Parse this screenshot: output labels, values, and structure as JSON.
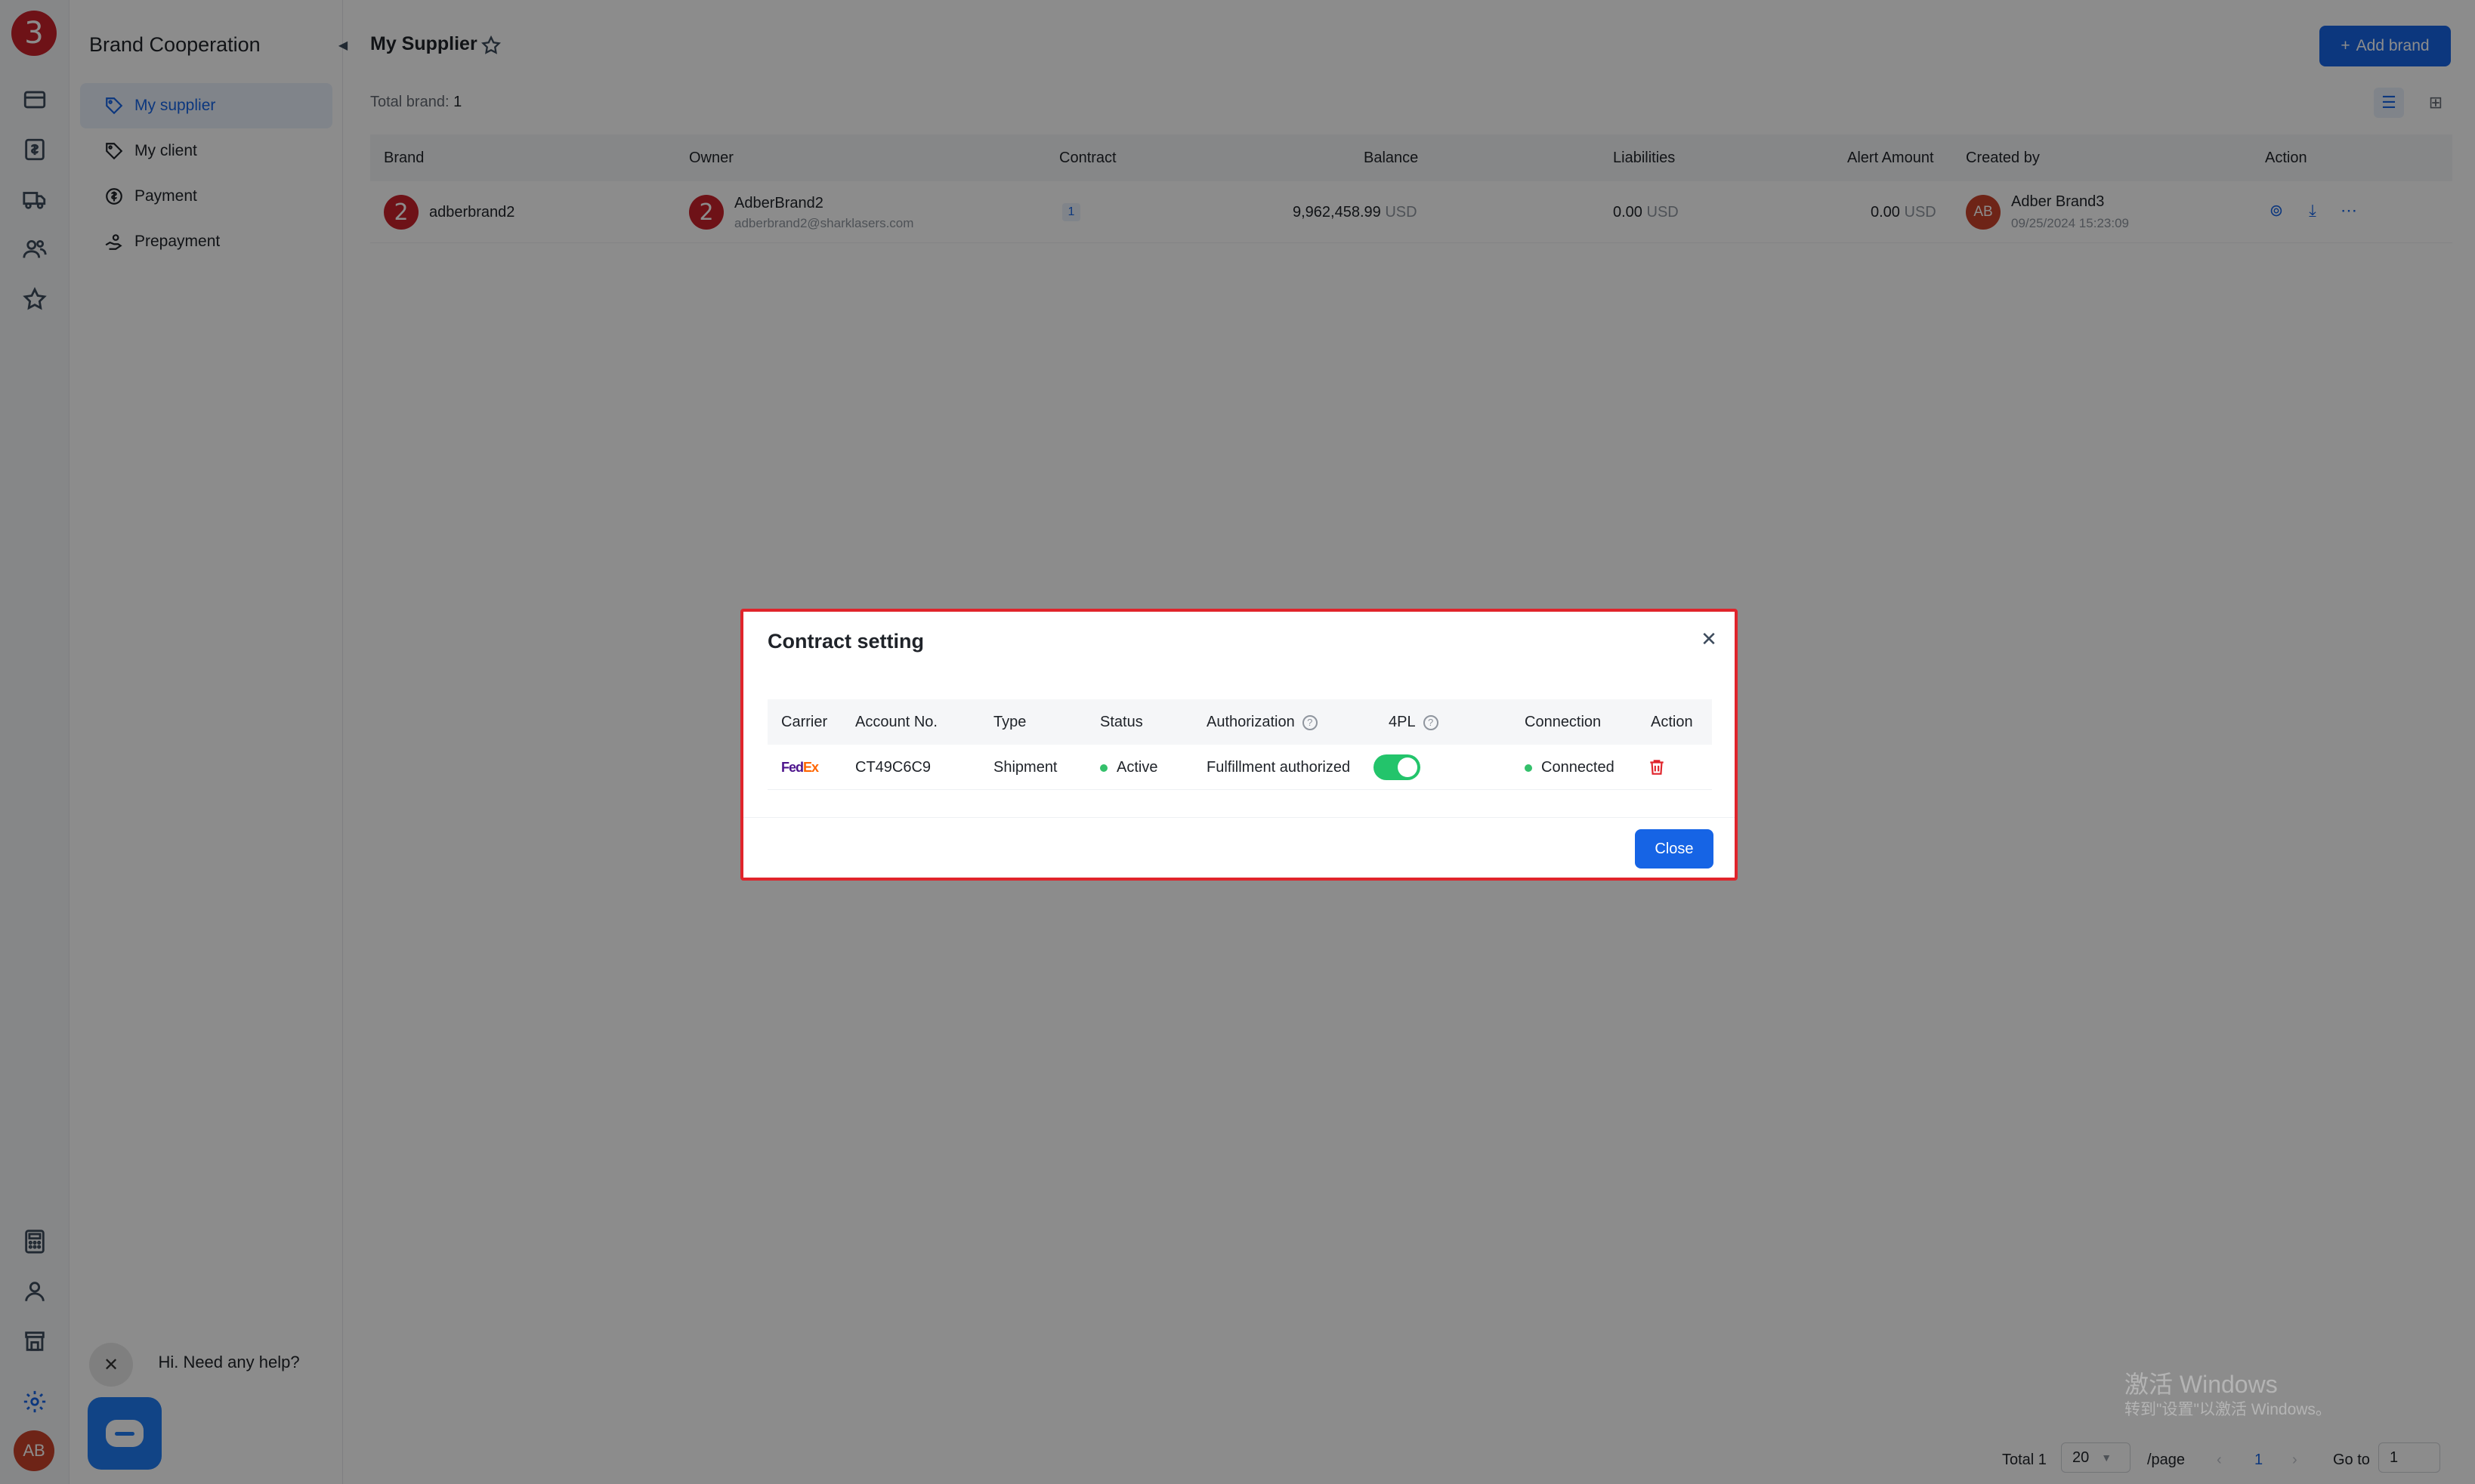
{
  "app": {
    "logo_text": "3",
    "avatar_initials": "AB"
  },
  "rail_icons": [
    "wallet-icon",
    "ledger-icon",
    "truck-icon",
    "users-icon",
    "star-icon",
    "calculator-icon",
    "person-icon",
    "store-icon",
    "gear-icon"
  ],
  "sidebar": {
    "title": "Brand Cooperation",
    "items": [
      {
        "label": "My supplier",
        "icon": "tag-icon",
        "active": true
      },
      {
        "label": "My client",
        "icon": "tag-icon",
        "active": false
      },
      {
        "label": "Payment",
        "icon": "dollar-icon",
        "active": false
      },
      {
        "label": "Prepayment",
        "icon": "hand-icon",
        "active": false
      }
    ]
  },
  "page": {
    "title": "My Supplier",
    "add_button": "Add brand",
    "total_label": "Total brand:",
    "total_value": "1"
  },
  "table": {
    "headers": [
      "Brand",
      "Owner",
      "Contract",
      "Balance",
      "Liabilities",
      "Alert Amount",
      "Created by",
      "Action"
    ],
    "row": {
      "brand_avatar": "2",
      "brand_name": "adberbrand2",
      "owner_avatar": "2",
      "owner_name": "AdberBrand2",
      "owner_email": "adberbrand2@sharklasers.com",
      "contract_count": "1",
      "balance": "9,962,458.99",
      "balance_currency": "USD",
      "liabilities": "0.00",
      "liabilities_currency": "USD",
      "alert_amount": "0.00",
      "alert_currency": "USD",
      "creator_initials": "AB",
      "creator_name": "Adber Brand3",
      "created_at": "09/25/2024 15:23:09"
    }
  },
  "modal": {
    "title": "Contract setting",
    "headers": [
      "Carrier",
      "Account No.",
      "Type",
      "Status",
      "Authorization",
      "4PL",
      "Connection",
      "Action"
    ],
    "row": {
      "carrier_logo_fe": "Fed",
      "carrier_logo_ex": "Ex",
      "account_no": "CT49C6C9",
      "type": "Shipment",
      "status": "Active",
      "authorization": "Fulfillment authorized",
      "fourpl_enabled": true,
      "connection": "Connected"
    },
    "close_button": "Close"
  },
  "chat": {
    "greeting": "Hi. Need any help?"
  },
  "watermark": {
    "line1": "激活 Windows",
    "line2": "转到\"设置\"以激活 Windows。"
  },
  "pagination": {
    "total_label": "Total 1",
    "page_size": "20",
    "per_page_label": "/page",
    "current_page": "1",
    "goto_label": "Go to",
    "goto_value": "1"
  }
}
